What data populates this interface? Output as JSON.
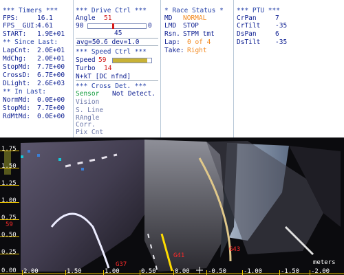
{
  "timers": {
    "header": "*** Timers ***",
    "fps_label": "FPS:",
    "fps_value": "16.1",
    "fps_gui_label": "FPS__GUI:",
    "fps_gui_value": "4.61",
    "start_label": "START:",
    "start_value": "1.9E+01",
    "since_header": "** Since Last:",
    "since_rows": [
      {
        "label": "LapCnt:",
        "value": "2.0E+01"
      },
      {
        "label": "MdChg:",
        "value": "2.0E+01"
      },
      {
        "label": "StopMd:",
        "value": "7.7E+00"
      },
      {
        "label": "CrossD:",
        "value": "6.7E+00"
      },
      {
        "label": "DLight:",
        "value": "2.6E+03"
      }
    ],
    "in_header": "** In Last:",
    "in_rows": [
      {
        "label": "NormMd:",
        "value": "0.0E+00"
      },
      {
        "label": "StopMd:",
        "value": "7.7E+00"
      },
      {
        "label": "RdMtMd:",
        "value": "0.0E+00"
      }
    ]
  },
  "drive": {
    "header": "*** Drive Ctrl ***",
    "angle_label": "Angle",
    "angle_value": "51",
    "range_left": "90",
    "range_right": "0",
    "angle_position": 0.43,
    "center_value": "45",
    "stats": "avg=50.6 dev=1.0",
    "speed_header": "*** Speed Ctrl ***",
    "speed_label": "Speed",
    "speed_value": "59",
    "speed_fraction": 0.9,
    "turbo_label": "Turbo",
    "turbo_value": "14",
    "nkt": "N+kT [DC nfnd]",
    "cross_header": "*** Cross Det. ***",
    "sensor_label": "Sensor",
    "sensor_value": "Not Detect.",
    "options": [
      "Vision",
      "S. Line",
      "RAngle",
      "Corr.",
      "Pix Cnt"
    ]
  },
  "race": {
    "header": "* Race Status *",
    "md_label": "MD",
    "md_value": "NORMAL",
    "lmd_label": "LMD",
    "lmd_value": "STOP",
    "rsn_label": "Rsn.",
    "rsn_value": "STPM tmt",
    "lap_label": "Lap:",
    "lap_value": "0 of 4",
    "take_label": "Take:",
    "take_value": "Right"
  },
  "ptu": {
    "header": "*** PTU ***",
    "rows": [
      {
        "label": "CrPan",
        "value": "7"
      },
      {
        "label": "CrTilt",
        "value": "-35"
      },
      {
        "label": "DsPan",
        "value": "6"
      },
      {
        "label": "DsTilt",
        "value": "-35"
      }
    ]
  },
  "scene": {
    "y_labels": [
      "1.75",
      "1.50",
      "1.25",
      "1.00",
      "0.75",
      "0.50",
      "0.25",
      "0.00"
    ],
    "x_labels": [
      "2.00",
      "1.50",
      "1.00",
      "0.50",
      "0.00",
      "-0.50",
      "-1.00",
      "-1.50",
      "-2.00"
    ],
    "x_unit": "meters",
    "markers": [
      "59",
      "G37",
      "G41",
      "G43"
    ],
    "colors": {
      "axis_yellow": "#f0c800",
      "marker_red": "#ff2a2a",
      "heading_line": "#ffdc00"
    }
  }
}
